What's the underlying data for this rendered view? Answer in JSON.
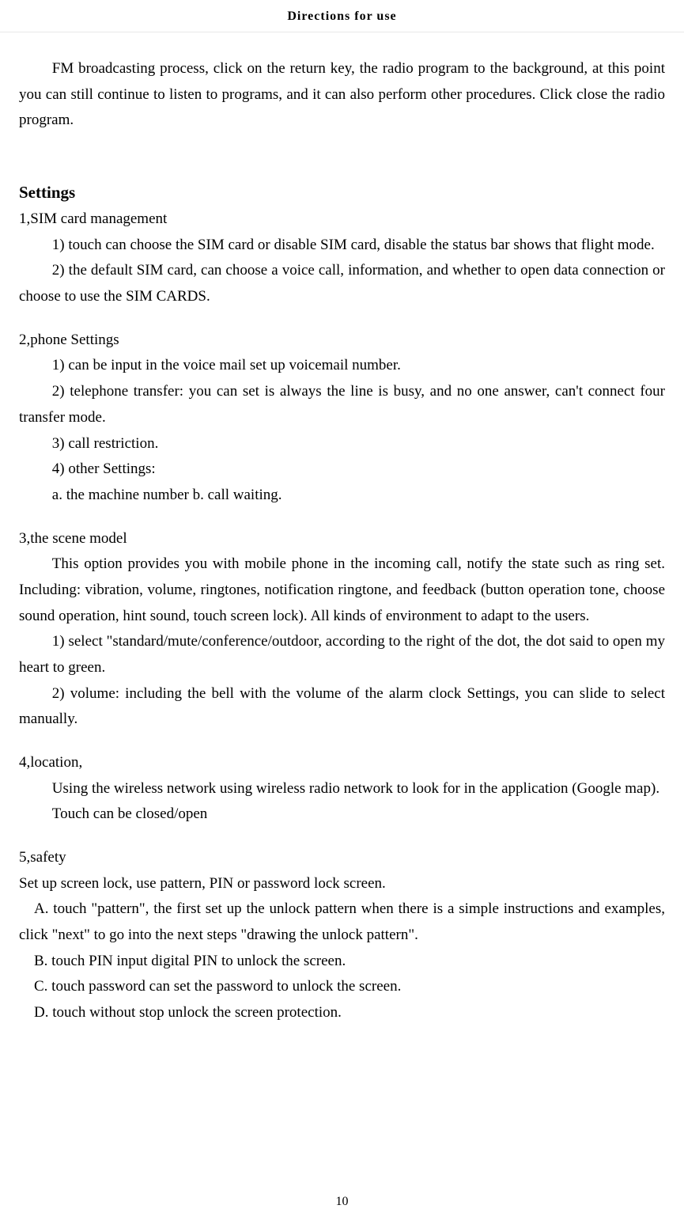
{
  "header": {
    "title": "Directions for use"
  },
  "intro": {
    "p1": "FM broadcasting process, click on the return key, the radio program to the background, at this point you can still continue to listen to programs, and it can also perform other procedures. Click close the radio program."
  },
  "settings": {
    "title": "Settings",
    "s1": {
      "title": "1,SIM card management",
      "i1": "1) touch can choose the SIM card or disable SIM card, disable the status bar shows that flight mode.",
      "i2": "2) the default SIM card, can choose a voice call, information, and whether to open data connection or choose to use the SIM CARDS."
    },
    "s2": {
      "title": "2,phone Settings",
      "i1": "1) can be input in the voice mail set up voicemail number.",
      "i2": "2) telephone transfer: you can set is always the line is busy, and no one answer, can't connect four transfer mode.",
      "i3": "3) call restriction.",
      "i4": "4) other Settings:",
      "i5": "a. the machine number b. call waiting."
    },
    "s3": {
      "title": "3,the scene model",
      "p1": "This option provides you with mobile phone in the incoming call, notify the state such as ring set. Including: vibration, volume, ringtones, notification ringtone, and feedback (button operation tone, choose sound operation, hint sound, touch screen lock). All kinds of environment to adapt to the users.",
      "i1": "1) select \"standard/mute/conference/outdoor, according to the right of the dot, the dot said to open my heart to green.",
      "i2": "2) volume: including the bell with the volume of the alarm clock Settings, you can slide to select manually."
    },
    "s4": {
      "title": "4,location,",
      "p1": "Using the wireless network using wireless radio network to look for in the application (Google map).",
      "p2": "Touch can be closed/open"
    },
    "s5": {
      "title": "5,safety",
      "p1": "Set up screen lock, use pattern, PIN or password lock screen.",
      "a": "A. touch \"pattern\", the first set up the unlock pattern when there is a simple instructions and examples, click \"next\" to go into the next steps \"drawing the unlock pattern\".",
      "b": "B. touch PIN input digital PIN to unlock the screen.",
      "c": "C. touch password can set the password to unlock the screen.",
      "d": "D. touch without stop unlock the screen protection."
    }
  },
  "page": {
    "number": "10"
  }
}
